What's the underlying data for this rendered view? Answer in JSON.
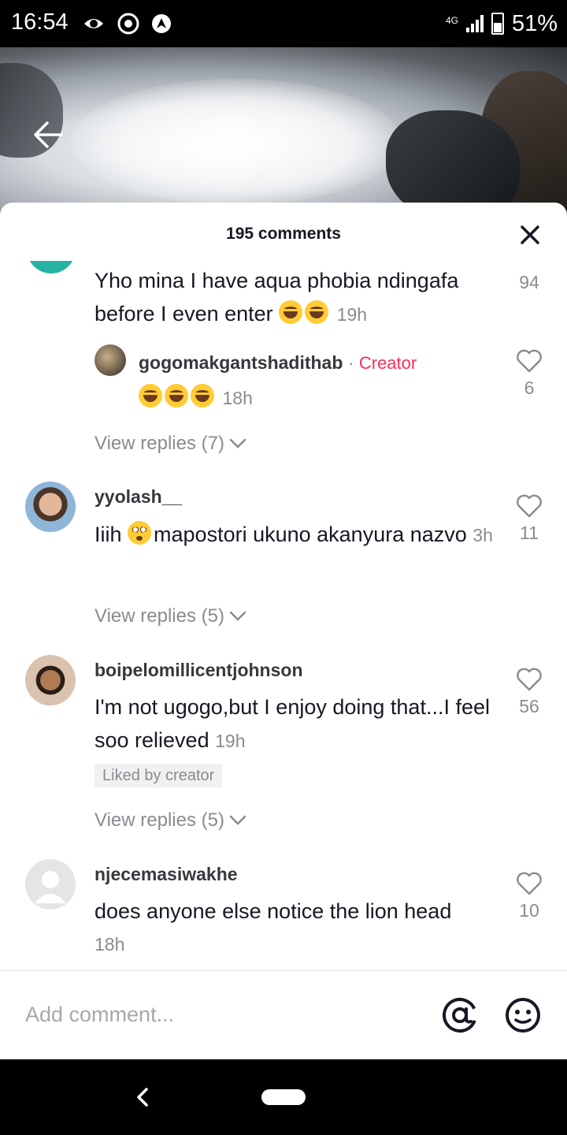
{
  "status_bar": {
    "time": "16:54",
    "network": "4G",
    "battery": "51%",
    "icons": [
      "camera-icon",
      "chrome-icon",
      "navigation-icon"
    ]
  },
  "video": {
    "back_icon": "arrow-left-icon"
  },
  "sheet": {
    "title": "195 comments",
    "close_icon": "close-icon"
  },
  "comments": [
    {
      "username": "",
      "text": "Yho mina I have aqua phobia ndingafa before I even enter",
      "emojis": [
        "sweat-smile",
        "sweat-smile"
      ],
      "time": "19h",
      "likes": "94",
      "reply": {
        "username": "gogomakgantshadithab",
        "separator": "·",
        "badge": "Creator",
        "emojis": [
          "joy",
          "sweat-smile",
          "joy"
        ],
        "time": "18h",
        "likes": "6"
      },
      "view_replies": "View replies (7)"
    },
    {
      "username": "yyolash__",
      "text_before": "Iiih",
      "emoji": "flushed",
      "text_after": "mapostori ukuno akanyura nazvo",
      "time": "3h",
      "likes": "11",
      "view_replies": "View replies (5)"
    },
    {
      "username": "boipelomillicentjohnson",
      "text": "I'm not ugogo,but I enjoy doing that...I feel soo relieved",
      "time": "19h",
      "likes": "56",
      "badge": "Liked by creator",
      "view_replies": "View replies (5)"
    },
    {
      "username": "njecemasiwakhe",
      "text": "does anyone else notice the lion head",
      "time": "18h",
      "likes": "10"
    }
  ],
  "input": {
    "placeholder": "Add comment...",
    "mention_icon": "at-icon",
    "emoji_icon": "emoji-icon"
  },
  "colors": {
    "accent": "#fe2c55",
    "muted": "#8a8b91",
    "text": "#161823",
    "teal_avatar": "#27b3a2"
  }
}
